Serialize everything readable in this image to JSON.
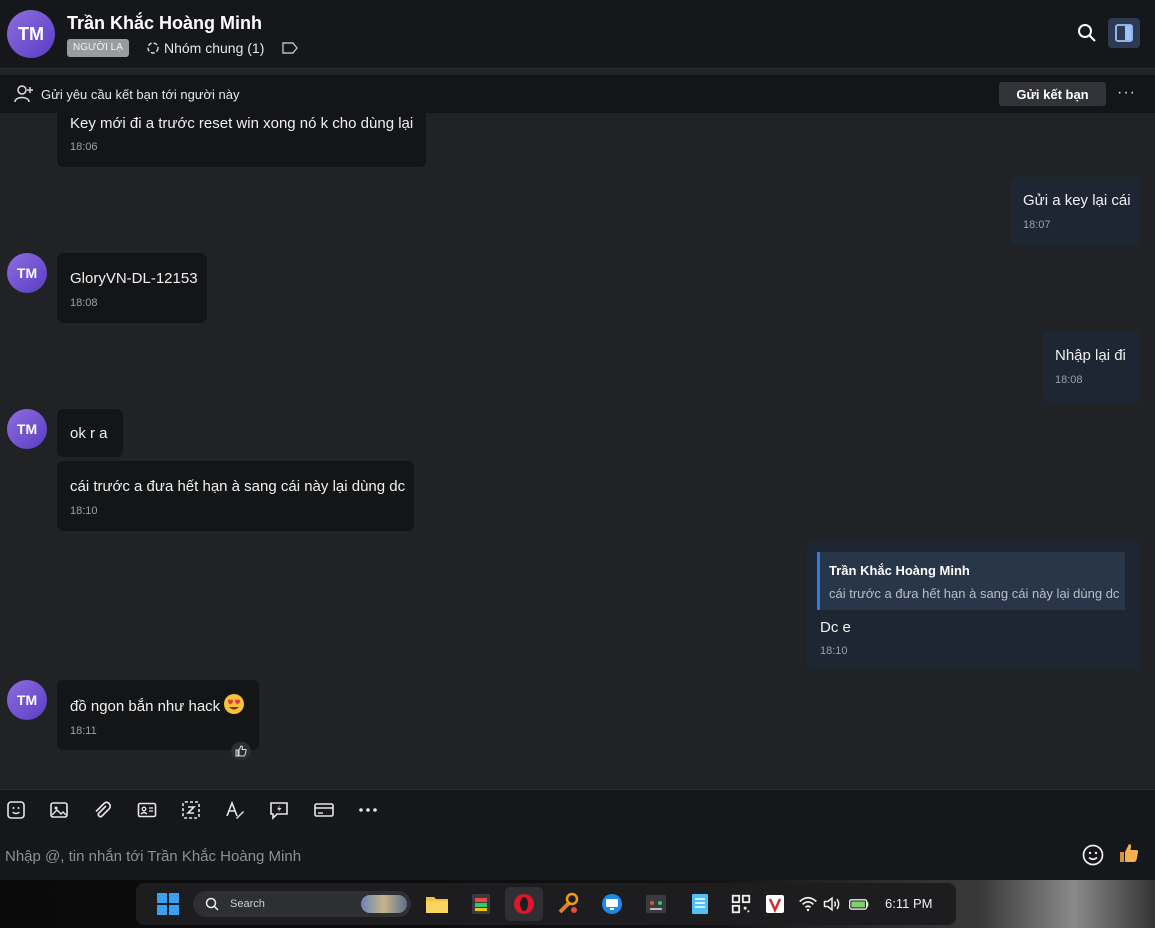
{
  "header": {
    "avatar_initials": "TM",
    "name": "Trần Khắc Hoàng Minh",
    "badge": "NGƯỜI LẠ",
    "group_label": "Nhóm chung (1)"
  },
  "friend_bar": {
    "text": "Gửi yêu cầu kết bạn tới người này",
    "button": "Gửi kết bạn",
    "more": "···"
  },
  "messages": [
    {
      "side": "them",
      "text": "Key mới đi a trước reset win xong nó k cho dùng lại",
      "time": "18:06"
    },
    {
      "side": "me",
      "text": "Gửi a key lại cái",
      "time": "18:07"
    },
    {
      "side": "them",
      "avatar": "TM",
      "text": "GloryVN-DL-12153",
      "time": "18:08"
    },
    {
      "side": "me",
      "text": "Nhập lại đi",
      "time": "18:08"
    },
    {
      "side": "them",
      "avatar": "TM",
      "text": "ok r a"
    },
    {
      "side": "them",
      "text": "cái trước a đưa hết hạn à sang cái này lại dùng dc",
      "time": "18:10"
    },
    {
      "side": "me",
      "quote_name": "Trần Khắc Hoàng Minh",
      "quote_text": "cái trước a đưa hết hạn à sang cái này lại dùng dc",
      "text": "Dc e",
      "time": "18:10"
    },
    {
      "side": "them",
      "avatar": "TM",
      "text": "đồ ngon bắn như hack",
      "emoji": "smiling-face-with-heart-eyes",
      "time": "18:11",
      "reaction": "thumbs-up"
    }
  ],
  "toolbar_icons": [
    "sticker-icon",
    "image-icon",
    "attach-icon",
    "contact-card-icon",
    "screenshot-icon",
    "text-format-icon",
    "quick-message-icon",
    "card-icon",
    "more-icon"
  ],
  "composer": {
    "placeholder": "Nhập @, tin nhắn tới Trần Khắc Hoàng Minh"
  },
  "taskbar": {
    "search_label": "Search",
    "time": "6:11 PM"
  },
  "colors": {
    "accent_blue": "#2a7de1",
    "avatar_purple": "#7a58d6",
    "bubble_mine": "#1e2634",
    "bubble_theirs": "#141517"
  }
}
